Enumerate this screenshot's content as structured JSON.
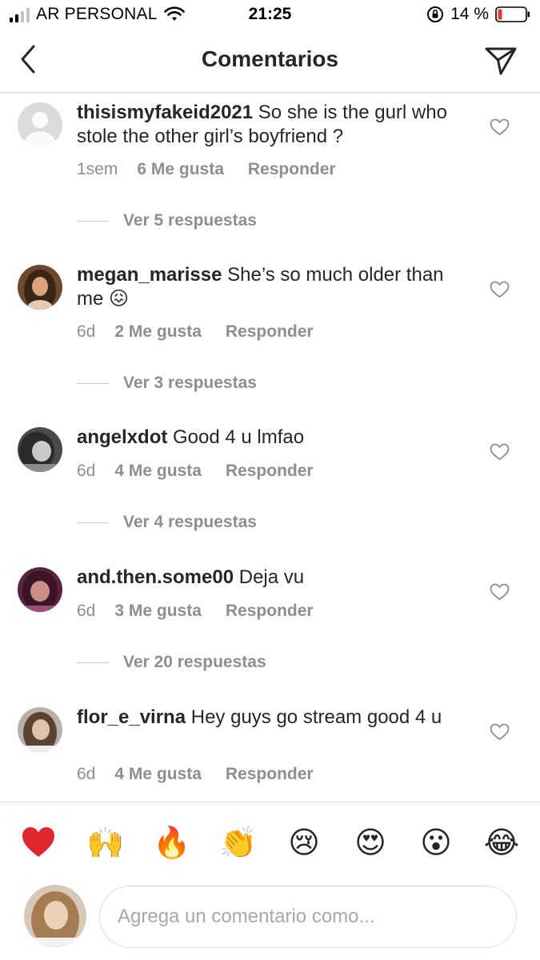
{
  "status_bar": {
    "carrier": "AR PERSONAL",
    "time": "21:25",
    "battery": "14 %",
    "battery_color": "#e53935"
  },
  "header": {
    "title": "Comentarios",
    "back_icon": "chevron-left-icon",
    "send_icon": "paper-plane-icon"
  },
  "comments": [
    {
      "username": "thisismyfakeid2021",
      "text": "So she is the gurl who stole the other girl’s boyfriend ?",
      "time": "1sem",
      "likes": "6 Me gusta",
      "reply": "Responder",
      "replies": "Ver 5 respuestas"
    },
    {
      "username": "megan_marisse",
      "text": "She’s so much older than me 😖",
      "time": "6d",
      "likes": "2 Me gusta",
      "reply": "Responder",
      "replies": "Ver 3 respuestas"
    },
    {
      "username": "angelxdot",
      "text": "Good 4 u lmfao",
      "time": "6d",
      "likes": "4 Me gusta",
      "reply": "Responder",
      "replies": "Ver 4 respuestas"
    },
    {
      "username": "and.then.some00",
      "text": "Deja vu",
      "time": "6d",
      "likes": "3 Me gusta",
      "reply": "Responder",
      "replies": "Ver 20 respuestas"
    },
    {
      "username": "flor_e_virna",
      "text": "Hey guys go stream good 4 u",
      "time": "6d",
      "likes": "4 Me gusta",
      "reply": "Responder"
    }
  ],
  "emoji_bar": [
    "❤️",
    "🙌",
    "🔥",
    "👏",
    "😢",
    "😍",
    "😮",
    "😂"
  ],
  "input": {
    "placeholder": "Agrega un comentario como..."
  }
}
